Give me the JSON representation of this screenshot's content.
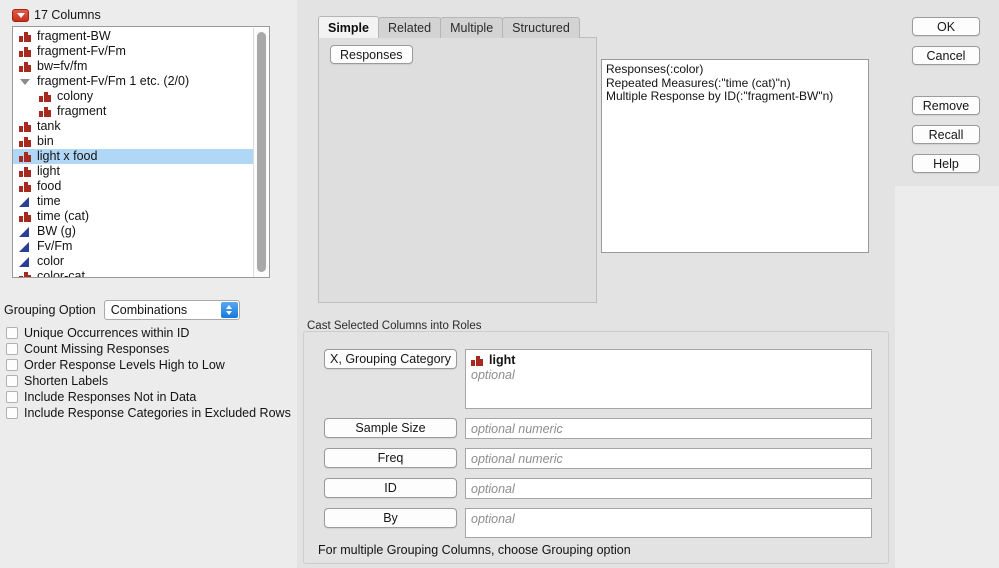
{
  "columns_panel": {
    "header_label": "17 Columns",
    "disclosure_icon": "red-triangle-down-icon",
    "items": [
      {
        "label": "fragment-BW",
        "icon": "nominal-icon",
        "indent": false,
        "selected": false,
        "expander": false
      },
      {
        "label": "fragment-Fv/Fm",
        "icon": "nominal-icon",
        "indent": false,
        "selected": false,
        "expander": false
      },
      {
        "label": "bw=fv/fm",
        "icon": "nominal-icon",
        "indent": false,
        "selected": false,
        "expander": false
      },
      {
        "label": "fragment-Fv/Fm 1 etc. (2/0)",
        "icon": "expander-icon",
        "indent": false,
        "selected": false,
        "expander": true
      },
      {
        "label": "colony",
        "icon": "nominal-icon",
        "indent": true,
        "selected": false,
        "expander": false
      },
      {
        "label": "fragment",
        "icon": "nominal-icon",
        "indent": true,
        "selected": false,
        "expander": false
      },
      {
        "label": "tank",
        "icon": "nominal-icon",
        "indent": false,
        "selected": false,
        "expander": false
      },
      {
        "label": "bin",
        "icon": "nominal-icon",
        "indent": false,
        "selected": false,
        "expander": false
      },
      {
        "label": "light x food",
        "icon": "nominal-icon",
        "indent": false,
        "selected": true,
        "expander": false
      },
      {
        "label": "light",
        "icon": "nominal-icon",
        "indent": false,
        "selected": false,
        "expander": false
      },
      {
        "label": "food",
        "icon": "nominal-icon",
        "indent": false,
        "selected": false,
        "expander": false
      },
      {
        "label": "time",
        "icon": "continuous-icon",
        "indent": false,
        "selected": false,
        "expander": false
      },
      {
        "label": "time (cat)",
        "icon": "nominal-icon",
        "indent": false,
        "selected": false,
        "expander": false
      },
      {
        "label": "BW (g)",
        "icon": "continuous-icon",
        "indent": false,
        "selected": false,
        "expander": false
      },
      {
        "label": "Fv/Fm",
        "icon": "continuous-icon",
        "indent": false,
        "selected": false,
        "expander": false
      },
      {
        "label": "color",
        "icon": "continuous-icon",
        "indent": false,
        "selected": false,
        "expander": false
      },
      {
        "label": "color-cat",
        "icon": "nominal-icon",
        "indent": false,
        "selected": false,
        "expander": false
      }
    ],
    "scrollbar": "vertical-scrollbar"
  },
  "grouping": {
    "label": "Grouping Option",
    "selected": "Combinations",
    "options": [
      "Combinations"
    ],
    "checkboxes": [
      {
        "label": "Unique Occurrences within ID",
        "checked": false
      },
      {
        "label": "Count Missing Responses",
        "checked": false
      },
      {
        "label": "Order Response Levels High to Low",
        "checked": false
      },
      {
        "label": "Shorten Labels",
        "checked": false
      },
      {
        "label": "Include Responses Not in Data",
        "checked": false
      },
      {
        "label": "Include Response Categories in Excluded Rows",
        "checked": false
      }
    ]
  },
  "tabs": [
    {
      "label": "Simple",
      "active": true
    },
    {
      "label": "Related",
      "active": false
    },
    {
      "label": "Multiple",
      "active": false
    },
    {
      "label": "Structured",
      "active": false
    }
  ],
  "tab_panel": {
    "responses_button": "Responses"
  },
  "script_box": {
    "lines": [
      "Responses(:color)",
      "Repeated Measures(:\"time (cat)\"n)",
      "Multiple Response by ID(:\"fragment-BW\"n)"
    ]
  },
  "roles": {
    "title": "Cast Selected Columns into Roles",
    "note": "For multiple Grouping Columns, choose Grouping option",
    "rows": [
      {
        "button": "X, Grouping Category",
        "entries": [
          {
            "label": "light",
            "icon": "nominal-icon"
          }
        ],
        "placeholder": "optional"
      },
      {
        "button": "Sample Size",
        "entries": [],
        "placeholder": "optional numeric"
      },
      {
        "button": "Freq",
        "entries": [],
        "placeholder": "optional numeric"
      },
      {
        "button": "ID",
        "entries": [],
        "placeholder": "optional"
      },
      {
        "button": "By",
        "entries": [],
        "placeholder": "optional"
      }
    ]
  },
  "buttons": {
    "ok": "OK",
    "cancel": "Cancel",
    "remove": "Remove",
    "recall": "Recall",
    "help": "Help"
  },
  "colors": {
    "nominal_icon": "#a72a20",
    "continuous_icon": "#2b3f96",
    "selection": "#b0d7f5",
    "accent_blue": "#1478e0",
    "disclosure_red": "#c7301d",
    "window_bg": "#ececec",
    "panel_bg": "#e3e3e3"
  }
}
